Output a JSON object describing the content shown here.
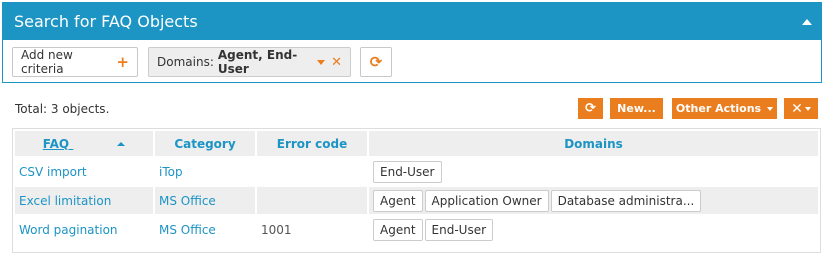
{
  "search": {
    "title": "Search for FAQ Objects",
    "add_criteria_label": "Add new criteria",
    "domains_criteria_prefix": "Domains:",
    "domains_criteria_value": "Agent, End-User"
  },
  "results": {
    "total": "Total: 3 objects.",
    "new_label": "New...",
    "other_actions_label": "Other Actions"
  },
  "table": {
    "columns": [
      "FAQ",
      "Category",
      "Error code",
      "Domains"
    ],
    "rows": [
      {
        "faq": "CSV import",
        "category": "iTop",
        "error_code": "",
        "domains": [
          "End-User"
        ]
      },
      {
        "faq": "Excel limitation",
        "category": "MS Office",
        "error_code": "",
        "domains": [
          "Agent",
          "Application Owner",
          "Database administra..."
        ]
      },
      {
        "faq": "Word pagination",
        "category": "MS Office",
        "error_code": "1001",
        "domains": [
          "Agent",
          "End-User"
        ]
      }
    ]
  },
  "colors": {
    "accent": "#1c94c4",
    "action": "#ea7d1e",
    "header_bg": "#eeeeee"
  },
  "icons": [
    "collapse-icon",
    "plus-icon",
    "caret-down-icon",
    "remove-icon",
    "refresh-icon",
    "tools-icon",
    "sort-ascending-icon"
  ]
}
